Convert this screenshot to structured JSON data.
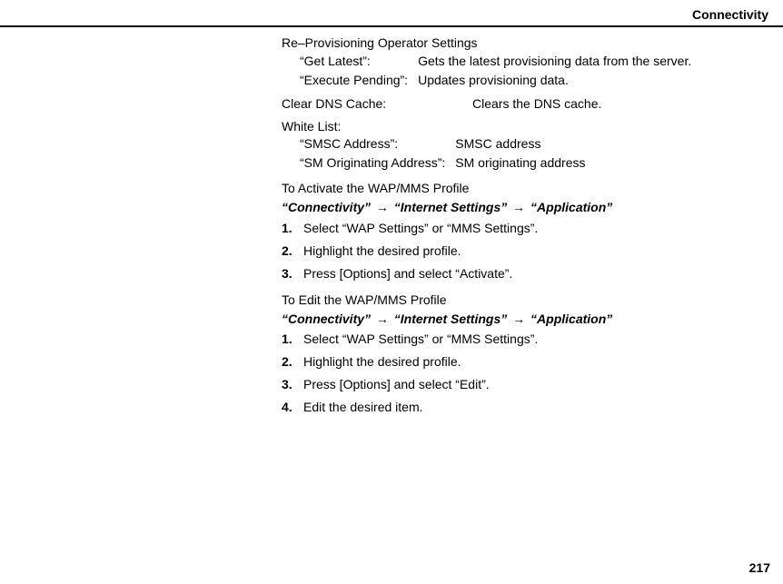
{
  "header": {
    "title": "Connectivity"
  },
  "reprov": {
    "title": "Re–Provisioning Operator Settings",
    "items": [
      {
        "label": "“Get Latest”:",
        "desc": "Gets the latest provisioning data from the server."
      },
      {
        "label": "“Execute Pending”:",
        "desc": "Updates provisioning data."
      }
    ]
  },
  "clear_dns": {
    "label": "Clear DNS Cache:",
    "desc": "Clears the DNS cache."
  },
  "whitelist": {
    "title": "White List:",
    "items": [
      {
        "label": "“SMSC Address”:",
        "desc": "SMSC address"
      },
      {
        "label": "“SM Originating Address”:",
        "desc": "SM originating address"
      }
    ]
  },
  "activate": {
    "heading": "To Activate the WAP/MMS Profile",
    "path": [
      "“Connectivity”",
      "“Internet Settings”",
      "“Application”"
    ],
    "steps": [
      "Select “WAP Settings” or “MMS Settings”.",
      "Highlight the desired profile.",
      "Press [Options] and select “Activate”."
    ]
  },
  "edit": {
    "heading": "To Edit the WAP/MMS Profile",
    "path": [
      "“Connectivity”",
      "“Internet Settings”",
      "“Application”"
    ],
    "steps": [
      "Select “WAP Settings” or “MMS Settings”.",
      "Highlight the desired profile.",
      "Press [Options] and select “Edit”.",
      "Edit the desired item."
    ]
  },
  "page_number": "217",
  "arrow_glyph": "→"
}
